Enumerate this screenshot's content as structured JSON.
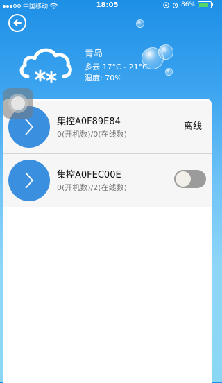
{
  "status_bar": {
    "carrier": "中国移动",
    "time": "18:05",
    "battery_percent": "86%",
    "battery_level": 0.86
  },
  "weather": {
    "city": "青岛",
    "temperature": "多云 17°C - 21°C",
    "humidity": "湿度: 70%",
    "icon": "cloud-snow-icon"
  },
  "devices": [
    {
      "title": "集控A0F89E84",
      "subtitle": "0(开机数)/0(在线数)",
      "status": "离线"
    },
    {
      "title": "集控A0FEC00E",
      "subtitle": "0(开机数)/2(在线数)",
      "toggle_on": false
    }
  ],
  "colors": {
    "accent_blue": "#3b8fdf",
    "header_blue": "#1d8fe6",
    "toggle_off": "#9b9b9b",
    "battery_green": "#53d769"
  }
}
